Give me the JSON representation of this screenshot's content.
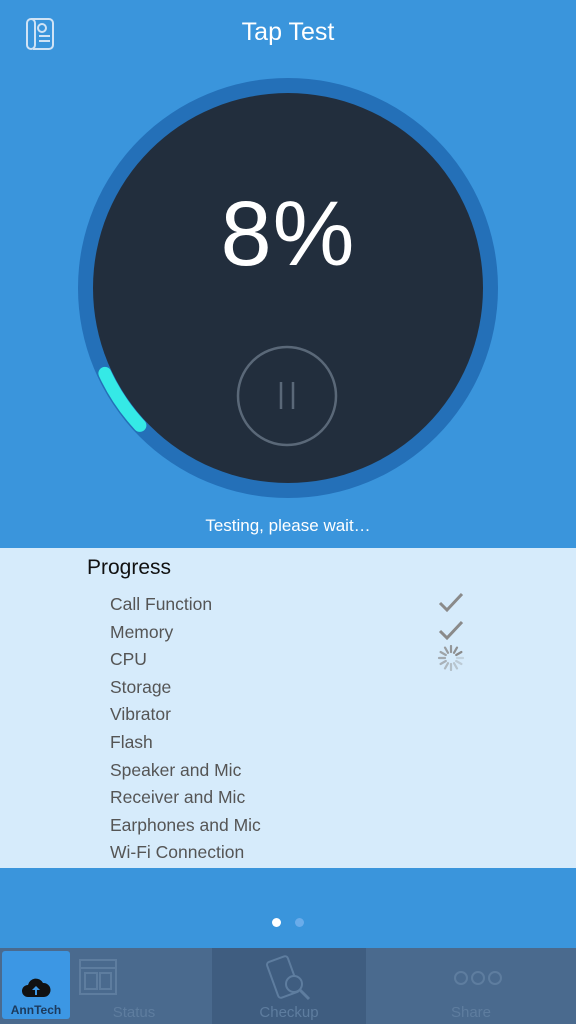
{
  "header": {
    "title": "Tap Test",
    "report_icon": "report-scroll-icon"
  },
  "dial": {
    "percent_text": "8%",
    "progress": 0.08,
    "pause_icon": "pause-icon"
  },
  "status": {
    "message": "Testing, please wait…"
  },
  "progress_panel": {
    "heading": "Progress",
    "items": [
      {
        "label": "Call Function",
        "state": "done"
      },
      {
        "label": "Memory",
        "state": "done"
      },
      {
        "label": "CPU",
        "state": "running"
      },
      {
        "label": "Storage",
        "state": "pending"
      },
      {
        "label": "Vibrator",
        "state": "pending"
      },
      {
        "label": "Flash",
        "state": "pending"
      },
      {
        "label": "Speaker and Mic",
        "state": "pending"
      },
      {
        "label": "Receiver and Mic",
        "state": "pending"
      },
      {
        "label": "Earphones and Mic",
        "state": "pending"
      },
      {
        "label": "Wi-Fi Connection",
        "state": "pending"
      }
    ]
  },
  "pager": {
    "page_count": 2,
    "current_page": 1
  },
  "tabbar": {
    "fab": {
      "label": "AnnTech",
      "icon": "cloud-upload-icon"
    },
    "tabs": [
      {
        "label": "Status",
        "icon": "window-icon"
      },
      {
        "label": "Checkup",
        "icon": "phone-search-icon"
      },
      {
        "label": "Share",
        "icon": "more-dots-icon"
      }
    ]
  },
  "colors": {
    "background": "#3a95dc",
    "dial_ring": "#2470b8",
    "dial_face": "#222e3d",
    "progress_arc": "#35e9e6",
    "panel": "#d6ebfb",
    "tabbar": "#4a6a8e"
  }
}
